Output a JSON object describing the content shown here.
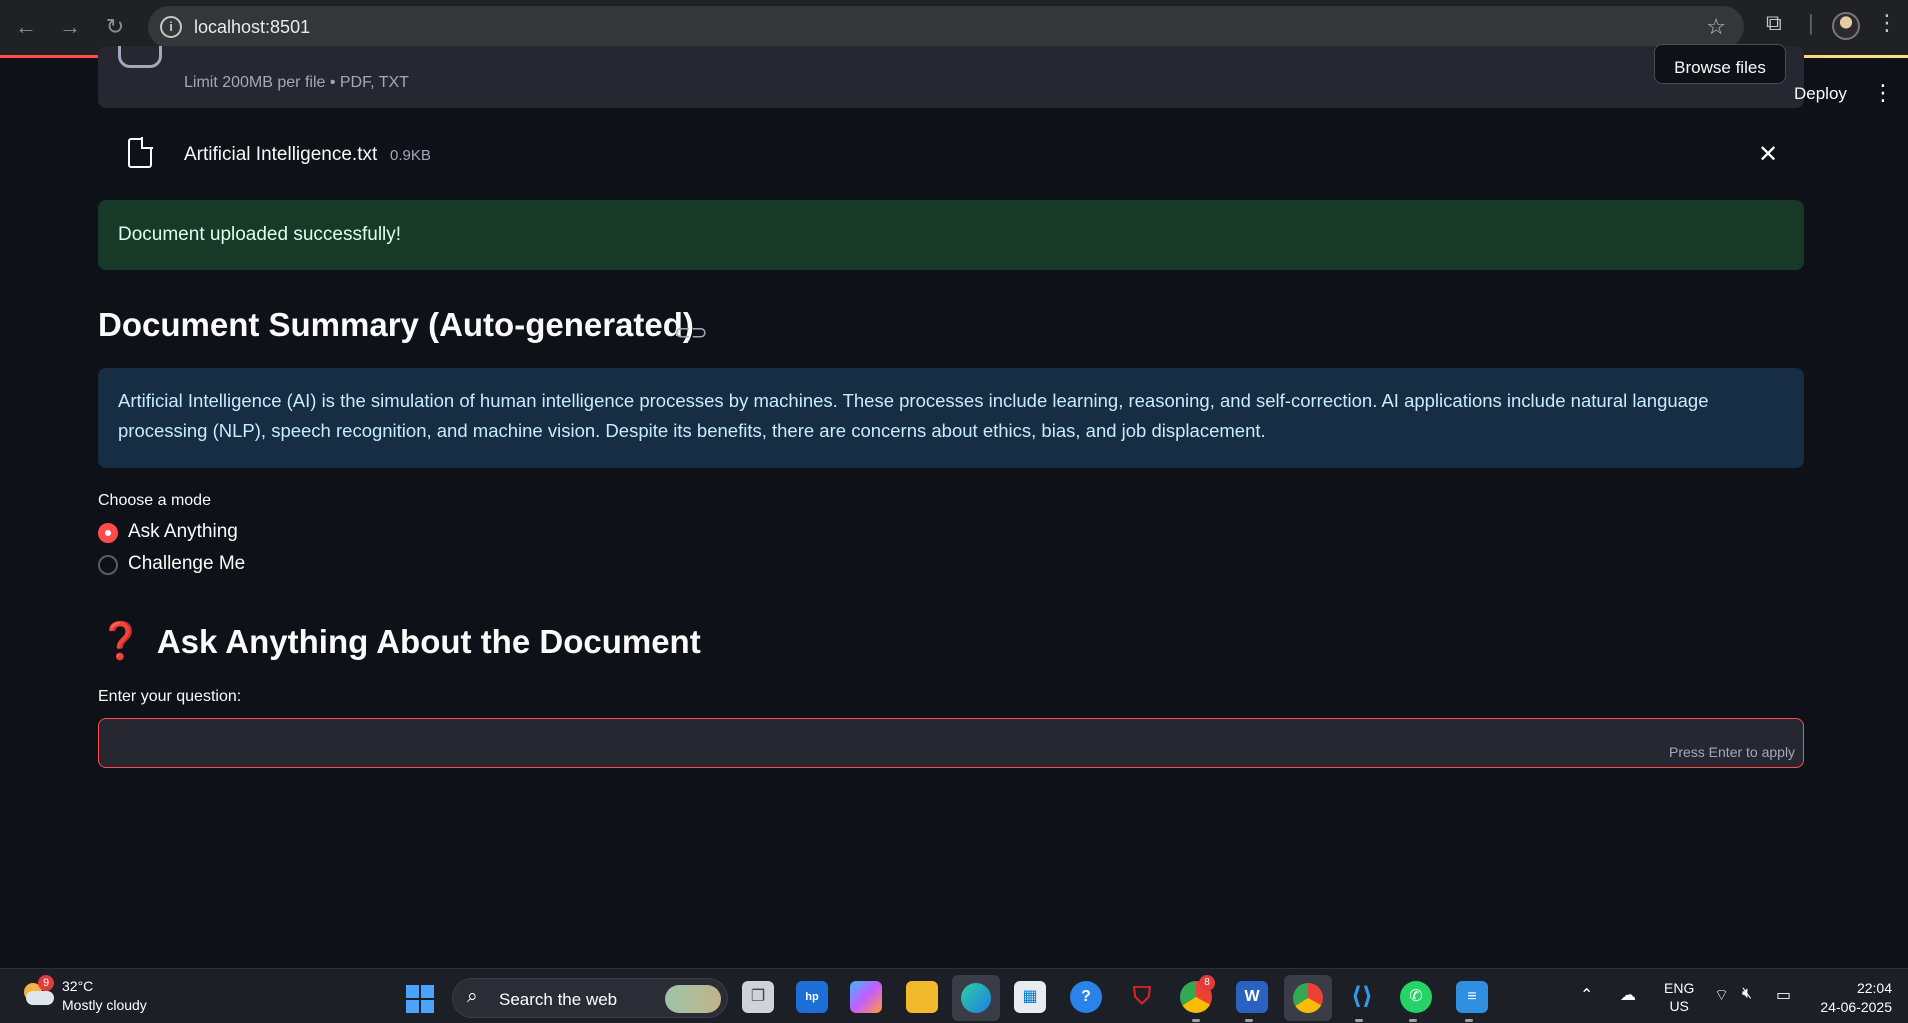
{
  "browser": {
    "url": "localhost:8501"
  },
  "header": {
    "deploy_label": "Deploy"
  },
  "uploader": {
    "limit_text": "Limit 200MB per file • PDF, TXT",
    "browse_label": "Browse files"
  },
  "file": {
    "name": "Artificial Intelligence.txt",
    "size": "0.9KB"
  },
  "success_message": "Document uploaded successfully!",
  "summary": {
    "heading": "Document Summary (Auto-generated)",
    "text": "Artificial Intelligence (AI) is the simulation of human intelligence processes by machines. These processes include learning, reasoning, and self-correction. AI applications include natural language processing (NLP), speech recognition, and machine vision. Despite its benefits, there are concerns about ethics, bias, and job displacement."
  },
  "mode": {
    "label": "Choose a mode",
    "options": [
      {
        "label": "Ask Anything",
        "selected": true
      },
      {
        "label": "Challenge Me",
        "selected": false
      }
    ]
  },
  "ask": {
    "heading": "Ask Anything About the Document",
    "question_label": "Enter your question:",
    "question_value": "",
    "hint": "Press Enter to apply"
  },
  "taskbar": {
    "weather_badge": "9",
    "temperature": "32°C",
    "weather": "Mostly cloudy",
    "search_text": "Search the web",
    "chrome_badge": "8",
    "lang_line1": "ENG",
    "lang_line2": "US",
    "time": "22:04",
    "date": "24-06-2025"
  },
  "colors": {
    "accent": "#ff4b4b",
    "background": "#0e1117",
    "success_bg": "#173928",
    "info_bg": "#172d43"
  }
}
